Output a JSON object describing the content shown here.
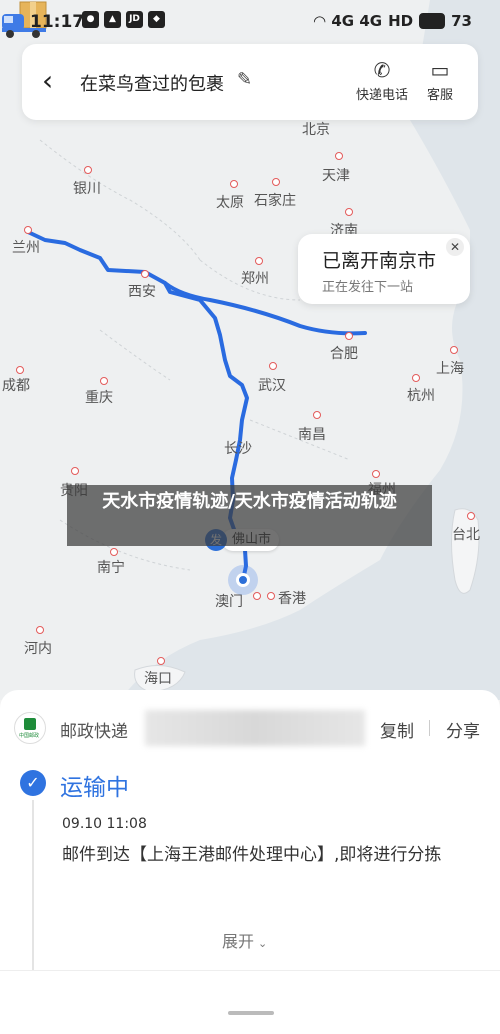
{
  "status_bar": {
    "time": "11:17",
    "network": "4G 4G",
    "hd": "HD",
    "battery": "73"
  },
  "header": {
    "back_icon": "chevron-left-icon",
    "title": "在菜鸟查过的包裹",
    "edit_icon": "pencil-icon",
    "actions": [
      {
        "icon": "phone-icon",
        "label": "快递电话"
      },
      {
        "icon": "chat-icon",
        "label": "客服"
      }
    ]
  },
  "map": {
    "cities": [
      "北京",
      "银川",
      "天津",
      "太原",
      "石家庄",
      "兰州",
      "济南",
      "郑州",
      "西安",
      "合肥",
      "上海",
      "成都",
      "重庆",
      "武汉",
      "杭州",
      "长沙",
      "南昌",
      "贵阳",
      "福州",
      "台北",
      "南宁",
      "佛山市",
      "澳门",
      "香港",
      "河内",
      "海口"
    ],
    "route_color": "#2a6be0",
    "status_bubble": {
      "title": "已离开南京市",
      "subtitle": "正在发往下一站",
      "close_icon": "close-icon"
    },
    "origin_marker": {
      "label": "发",
      "city": "佛山市"
    },
    "current_marker_icon": "location-dot-icon",
    "truck_icon": "truck-icon"
  },
  "watermark": {
    "text": "天水市疫情轨迹/天水市疫情活动轨迹"
  },
  "sheet": {
    "carrier_logo": "china-post-logo",
    "logo_text": "中国邮政",
    "carrier": "邮政快递",
    "copy_label": "复制",
    "share_label": "分享",
    "status_icon": "check-circle-icon",
    "status": "运输中",
    "time": "09.10 11:08",
    "detail": "邮件到达【上海王港邮件处理中心】,即将进行分拣",
    "expand_label": "展开",
    "expand_icon": "chevron-down-icon"
  }
}
